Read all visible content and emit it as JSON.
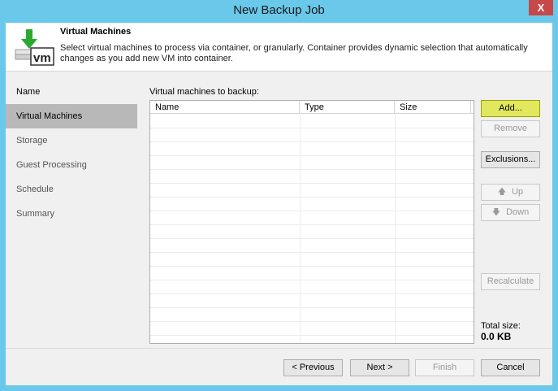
{
  "window": {
    "title": "New Backup Job",
    "close_label": "X"
  },
  "header": {
    "icon": "vm-download-icon",
    "title": "Virtual Machines",
    "description": "Select virtual machines to process via container, or granularly. Container provides dynamic selection that automatically changes as you add new VM into container."
  },
  "nav": {
    "items": [
      {
        "label": "Name"
      },
      {
        "label": "Virtual Machines"
      },
      {
        "label": "Storage"
      },
      {
        "label": "Guest Processing"
      },
      {
        "label": "Schedule"
      },
      {
        "label": "Summary"
      }
    ]
  },
  "vmlist": {
    "label": "Virtual machines to backup:",
    "columns": [
      "Name",
      "Type",
      "Size"
    ],
    "rows": []
  },
  "buttons": {
    "add": "Add...",
    "remove": "Remove",
    "exclusions": "Exclusions...",
    "up": "Up",
    "down": "Down",
    "recalculate": "Recalculate"
  },
  "total": {
    "label": "Total size:",
    "value": "0.0 KB"
  },
  "footer": {
    "previous": "< Previous",
    "next": "Next >",
    "finish": "Finish",
    "cancel": "Cancel"
  },
  "colors": {
    "titlebar": "#6ac8ea",
    "highlight": "#e1e85d",
    "nav_active": "#b8b8b8",
    "close": "#c74848"
  }
}
